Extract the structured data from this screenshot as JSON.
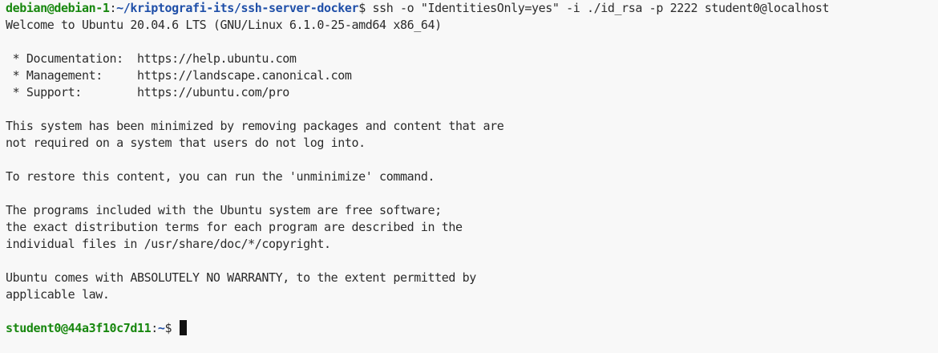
{
  "terminal": {
    "colors": {
      "background": "#f8f8f8",
      "text": "#2b2b2b",
      "prompt_user": "#17870e",
      "prompt_path": "#1f4fa8"
    },
    "command_line": {
      "user_host": "debian@debian-1",
      "colon": ":",
      "path": "~/kriptografi-its/ssh-server-docker",
      "dollar": "$ ",
      "command": "ssh -o \"IdentitiesOnly=yes\" -i ./id_rsa -p 2222 student0@localhost"
    },
    "output": [
      "Welcome to Ubuntu 20.04.6 LTS (GNU/Linux 6.1.0-25-amd64 x86_64)",
      "",
      " * Documentation:  https://help.ubuntu.com",
      " * Management:     https://landscape.canonical.com",
      " * Support:        https://ubuntu.com/pro",
      "",
      "This system has been minimized by removing packages and content that are",
      "not required on a system that users do not log into.",
      "",
      "To restore this content, you can run the 'unminimize' command.",
      "",
      "The programs included with the Ubuntu system are free software;",
      "the exact distribution terms for each program are described in the",
      "individual files in /usr/share/doc/*/copyright.",
      "",
      "Ubuntu comes with ABSOLUTELY NO WARRANTY, to the extent permitted by",
      "applicable law.",
      ""
    ],
    "final_prompt": {
      "user_host": "student0@44a3f10c7d11",
      "colon": ":",
      "path": "~",
      "dollar": "$ "
    }
  }
}
